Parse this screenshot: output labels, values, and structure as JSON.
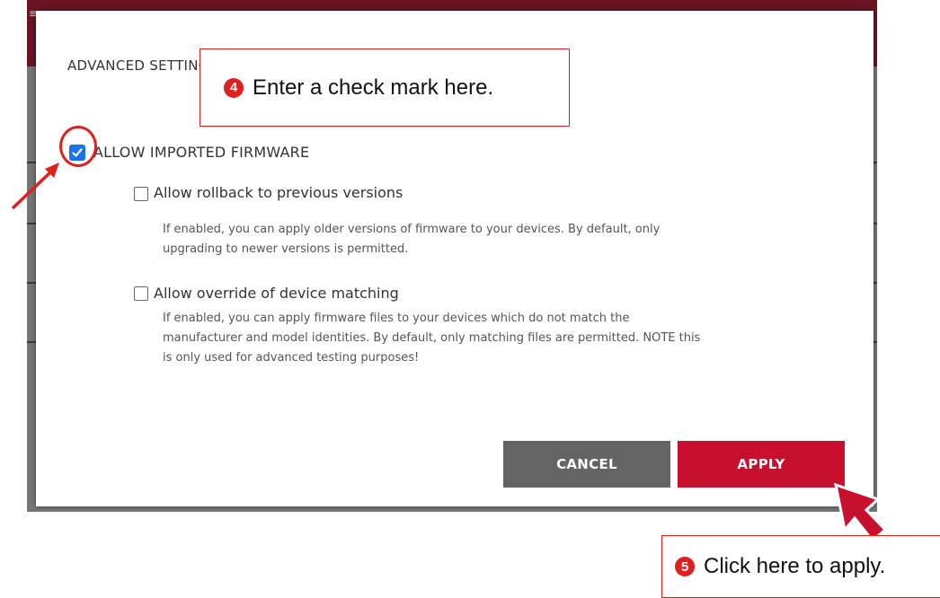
{
  "dialog": {
    "title": "ADVANCED SETTINGS",
    "main_option": {
      "label": "ALLOW IMPORTED FIRMWARE",
      "checked": true
    },
    "options": [
      {
        "label": "Allow rollback to previous versions",
        "checked": false,
        "description_lines": [
          "If enabled, you can apply older versions of firmware to your devices. By default, only",
          "upgrading to newer versions is permitted."
        ]
      },
      {
        "label": "Allow override of device matching",
        "checked": false,
        "description_lines": [
          "If enabled, you can apply firmware files to your devices which do not match the",
          "manufacturer and model identities. By default, only matching files are permitted. NOTE this",
          "is only used for advanced testing purposes!"
        ]
      }
    ],
    "buttons": {
      "cancel": "CANCEL",
      "apply": "APPLY"
    }
  },
  "annotations": {
    "step4": {
      "number": "4",
      "text": "Enter a check mark here."
    },
    "step5": {
      "number": "5",
      "text": "Click here to apply."
    }
  },
  "colors": {
    "accent_red": "#c8102e",
    "annotation_red": "#e0201e",
    "checkbox_blue": "#1a73e8",
    "cancel_gray": "#646464"
  }
}
